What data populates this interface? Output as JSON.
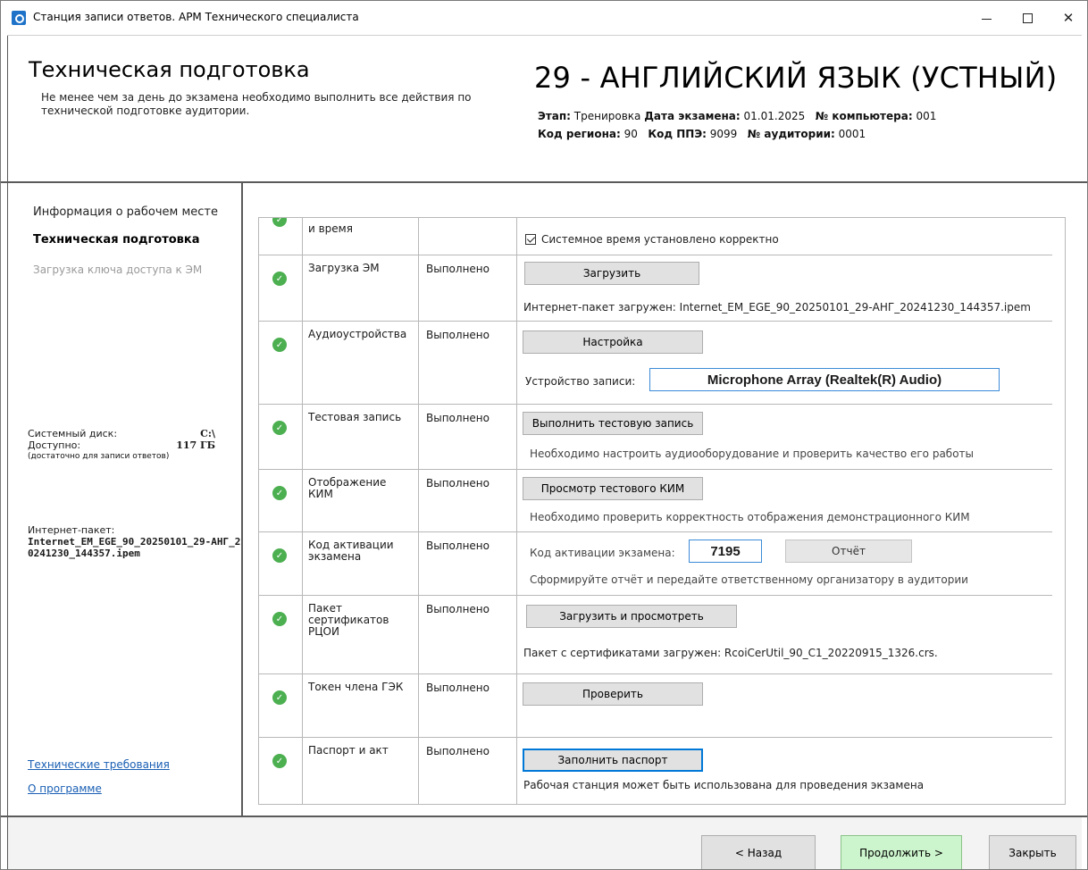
{
  "window": {
    "title": "Станция записи ответов. АРМ Технического специалиста",
    "minimize_glyph": "—",
    "close_glyph": "✕"
  },
  "header": {
    "title": "Техническая подготовка",
    "subtitle": "Не менее чем за день до экзамена необходимо выполнить все действия по технической подготовке аудитории.",
    "exam_title": "29 - АНГЛИЙСКИЙ ЯЗЫК (УСТНЫЙ)",
    "meta": {
      "stage_label": "Этап:",
      "stage_value": "Тренировка",
      "date_label": "Дата экзамена:",
      "date_value": "01.01.2025",
      "pc_label": "№ компьютера:",
      "pc_value": "001",
      "region_label": "Код региона:",
      "region_value": "90",
      "ppe_label": "Код ППЭ:",
      "ppe_value": "9099",
      "room_label": "№ аудитории:",
      "room_value": "0001"
    }
  },
  "sidebar": {
    "nav": [
      "Информация о рабочем месте",
      "Техническая подготовка",
      "Загрузка ключа доступа к ЭМ"
    ],
    "disk": {
      "system_label": "Системный диск:",
      "system_value": "C:\\",
      "free_label": "Доступно:",
      "free_value": "117 ГБ",
      "note": "(достаточно для записи ответов)"
    },
    "package": {
      "label": "Интернет-пакет:",
      "name": "Internet_EM_EGE_90_20250101_29-АНГ_20241230_144357.ipem"
    },
    "links": [
      "Технические требования",
      "О программе"
    ]
  },
  "table": {
    "rows": [
      {
        "name": "и время",
        "status": "",
        "check_label": "Системное время установлено корректно"
      },
      {
        "name": "Загрузка ЭМ",
        "status": "Выполнено",
        "button": "Загрузить",
        "text": "Интернет-пакет загружен: Internet_EM_EGE_90_20250101_29-АНГ_20241230_144357.ipem"
      },
      {
        "name": "Аудиоустройства",
        "status": "Выполнено",
        "button": "Настройка",
        "label": "Устройство записи:",
        "device": "Microphone Array (Realtek(R) Audio)"
      },
      {
        "name": "Тестовая запись",
        "status": "Выполнено",
        "button": "Выполнить тестовую запись",
        "text": "Необходимо настроить аудиооборудование и проверить качество его работы"
      },
      {
        "name": "Отображение КИМ",
        "status": "Выполнено",
        "button": "Просмотр тестового КИМ",
        "text": "Необходимо проверить корректность отображения демонстрационного КИМ"
      },
      {
        "name": "Код активации экзамена",
        "status": "Выполнено",
        "label": "Код активации экзамена:",
        "code": "7195",
        "button": "Отчёт",
        "text": "Сформируйте отчёт и передайте ответственному организатору в аудитории"
      },
      {
        "name": "Пакет сертификатов РЦОИ",
        "status": "Выполнено",
        "button": "Загрузить и просмотреть",
        "text": "Пакет с сертификатами загружен: RcoiCerUtil_90_C1_20220915_1326.crs."
      },
      {
        "name": "Токен члена ГЭК",
        "status": "Выполнено",
        "button": "Проверить"
      },
      {
        "name": "Паспорт и акт",
        "status": "Выполнено",
        "button": "Заполнить паспорт",
        "text": "Рабочая станция может быть использована для проведения экзамена"
      }
    ]
  },
  "footer": {
    "back": "< Назад",
    "next": "Продолжить >",
    "close": "Закрыть"
  },
  "colors": {
    "accent": "#0078d7",
    "ok": "#4caf50",
    "link": "#1a5fb4",
    "primary_button": "#cdf5cd"
  }
}
